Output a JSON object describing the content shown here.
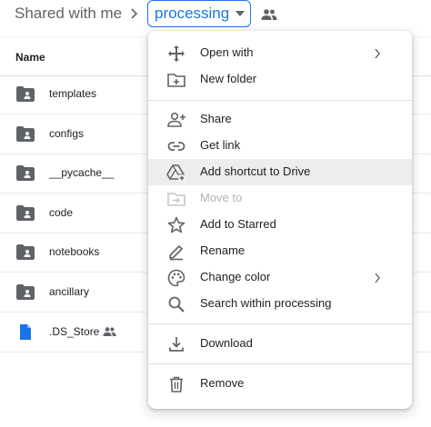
{
  "breadcrumb": {
    "root": "Shared with me",
    "current": "processing"
  },
  "list": {
    "name_header": "Name",
    "rows": [
      {
        "name": "templates",
        "icon": "shared-folder-icon"
      },
      {
        "name": "configs",
        "icon": "shared-folder-icon"
      },
      {
        "name": "__pycache__",
        "icon": "shared-folder-icon"
      },
      {
        "name": "code",
        "icon": "shared-folder-icon"
      },
      {
        "name": "notebooks",
        "icon": "shared-folder-icon"
      },
      {
        "name": "ancillary",
        "icon": "shared-folder-icon"
      },
      {
        "name": ".DS_Store",
        "icon": "file-icon"
      }
    ]
  },
  "menu": {
    "items": [
      {
        "label": "Open with",
        "icon": "move-arrows-icon",
        "submenu": true
      },
      {
        "label": "New folder",
        "icon": "new-folder-icon"
      },
      {
        "label": "Share",
        "icon": "person-add-icon"
      },
      {
        "label": "Get link",
        "icon": "link-icon"
      },
      {
        "label": "Add shortcut to Drive",
        "icon": "add-to-drive-icon",
        "highlighted": true
      },
      {
        "label": "Move to",
        "icon": "move-to-icon",
        "disabled": true
      },
      {
        "label": "Add to Starred",
        "icon": "star-icon"
      },
      {
        "label": "Rename",
        "icon": "pencil-icon"
      },
      {
        "label": "Change color",
        "icon": "palette-icon",
        "submenu": true
      },
      {
        "label": "Search within processing",
        "icon": "search-icon"
      },
      {
        "label": "Download",
        "icon": "download-icon"
      },
      {
        "label": "Remove",
        "icon": "trash-icon"
      }
    ]
  },
  "colors": {
    "accent": "#1a73e8",
    "icon_gray": "#5f6368",
    "highlight": "#ededed"
  }
}
